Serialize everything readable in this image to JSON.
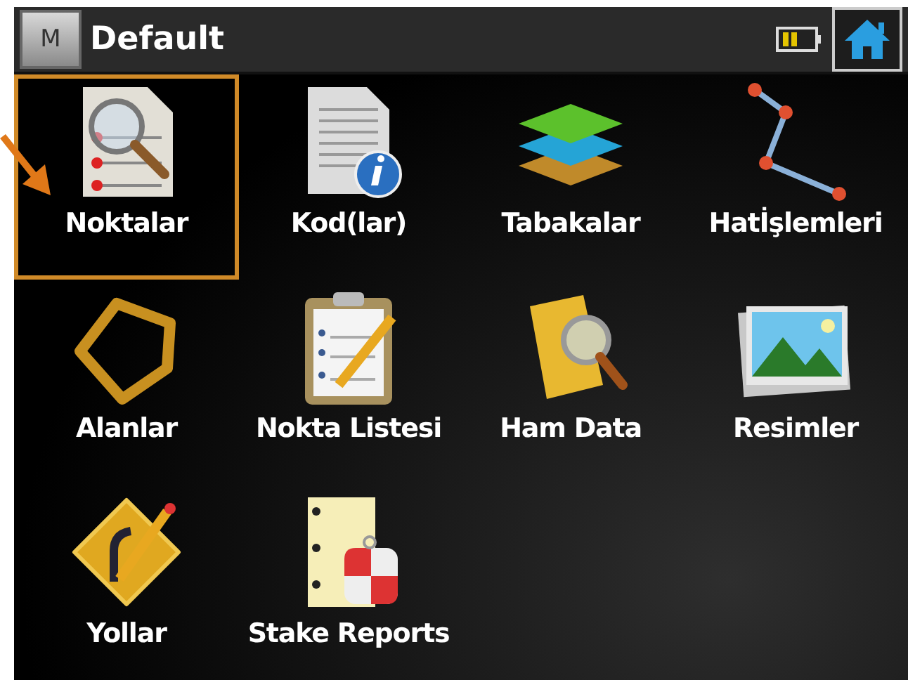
{
  "window": {
    "menu_button": "M",
    "title": "Default"
  },
  "items": [
    {
      "label": "Noktalar",
      "kind": "points",
      "selected": true
    },
    {
      "label": "Kod(lar)",
      "kind": "codes",
      "selected": false
    },
    {
      "label": "Tabakalar",
      "kind": "layers",
      "selected": false
    },
    {
      "label": "Hatİşlemleri",
      "kind": "polyline",
      "selected": false
    },
    {
      "label": "Alanlar",
      "kind": "areas",
      "selected": false
    },
    {
      "label": "Nokta Listesi",
      "kind": "pointlist",
      "selected": false
    },
    {
      "label": "Ham Data",
      "kind": "rawdata",
      "selected": false
    },
    {
      "label": "Resimler",
      "kind": "images",
      "selected": false
    },
    {
      "label": "Yollar",
      "kind": "roads",
      "selected": false
    },
    {
      "label": "Stake Reports",
      "kind": "stake",
      "selected": false
    }
  ]
}
